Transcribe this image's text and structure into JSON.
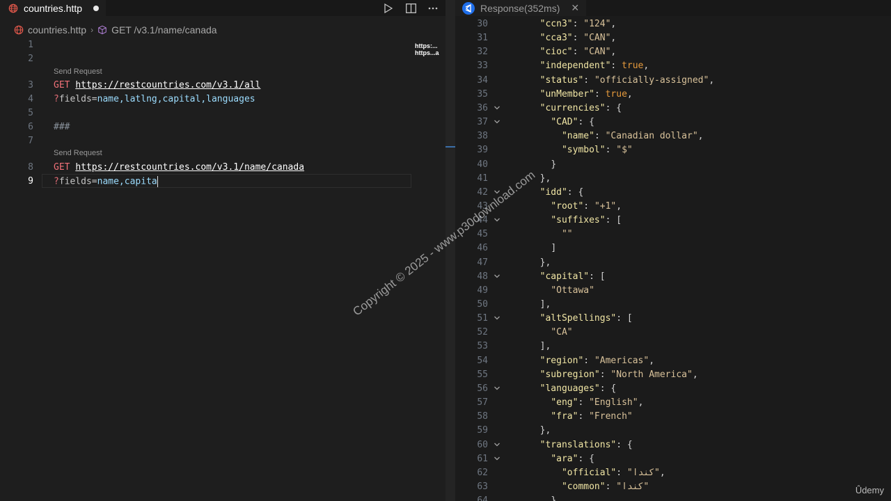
{
  "left_editor": {
    "tab_title": "countries.http",
    "breadcrumb": {
      "file": "countries.http",
      "symbol": "GET /v3.1/name/canada"
    },
    "minimap_text": [
      "https:...",
      "https...a"
    ],
    "codelens": [
      "Send Request",
      "Send Request"
    ],
    "line_numbers": [
      "1",
      "2",
      "3",
      "4",
      "5",
      "6",
      "7",
      "8",
      "9"
    ],
    "code": {
      "line3_method": "GET",
      "line3_url": "https://restcountries.com/v3.1/all",
      "line4_q": "?",
      "line4_param": "fields",
      "line4_eq": "=",
      "line4_value": "name,latlng,capital,languages",
      "line6_separator": "###",
      "line8_method": "GET",
      "line8_url": "https://restcountries.com/v3.1/name/canada",
      "line9_q": "?",
      "line9_param": "fields",
      "line9_eq": "=",
      "line9_value": "name,capita"
    }
  },
  "response": {
    "tab_title": "Response(352ms)",
    "lines": [
      {
        "n": "30",
        "t": "  \"ccn3\": \"124\","
      },
      {
        "n": "31",
        "t": "  \"cca3\": \"CAN\","
      },
      {
        "n": "32",
        "t": "  \"cioc\": \"CAN\","
      },
      {
        "n": "33",
        "t": "  \"independent\": true,"
      },
      {
        "n": "34",
        "t": "  \"status\": \"officially-assigned\","
      },
      {
        "n": "35",
        "t": "  \"unMember\": true,"
      },
      {
        "n": "36",
        "t": "  \"currencies\": {",
        "fold": true
      },
      {
        "n": "37",
        "t": "    \"CAD\": {",
        "fold": true
      },
      {
        "n": "38",
        "t": "      \"name\": \"Canadian dollar\","
      },
      {
        "n": "39",
        "t": "      \"symbol\": \"$\""
      },
      {
        "n": "40",
        "t": "    }"
      },
      {
        "n": "41",
        "t": "  },"
      },
      {
        "n": "42",
        "t": "  \"idd\": {",
        "fold": true
      },
      {
        "n": "43",
        "t": "    \"root\": \"+1\","
      },
      {
        "n": "44",
        "t": "    \"suffixes\": [",
        "fold": true
      },
      {
        "n": "45",
        "t": "      \"\""
      },
      {
        "n": "46",
        "t": "    ]"
      },
      {
        "n": "47",
        "t": "  },"
      },
      {
        "n": "48",
        "t": "  \"capital\": [",
        "fold": true
      },
      {
        "n": "49",
        "t": "    \"Ottawa\""
      },
      {
        "n": "50",
        "t": "  ],"
      },
      {
        "n": "51",
        "t": "  \"altSpellings\": [",
        "fold": true
      },
      {
        "n": "52",
        "t": "    \"CA\""
      },
      {
        "n": "53",
        "t": "  ],"
      },
      {
        "n": "54",
        "t": "  \"region\": \"Americas\","
      },
      {
        "n": "55",
        "t": "  \"subregion\": \"North America\","
      },
      {
        "n": "56",
        "t": "  \"languages\": {",
        "fold": true
      },
      {
        "n": "57",
        "t": "    \"eng\": \"English\","
      },
      {
        "n": "58",
        "t": "    \"fra\": \"French\""
      },
      {
        "n": "59",
        "t": "  },"
      },
      {
        "n": "60",
        "t": "  \"translations\": {",
        "fold": true
      },
      {
        "n": "61",
        "t": "    \"ara\": {",
        "fold": true
      },
      {
        "n": "62",
        "t": "      \"official\": \"كندا\","
      },
      {
        "n": "63",
        "t": "      \"common\": \"كندا\""
      },
      {
        "n": "64",
        "t": "    },"
      }
    ]
  },
  "watermark": "Copyright © 2025 - www.p30download.com",
  "brand": "Ûdemy"
}
